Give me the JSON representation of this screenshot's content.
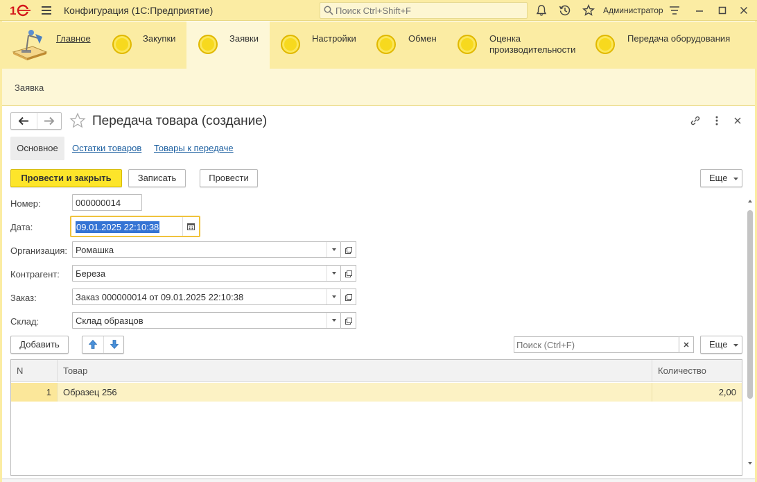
{
  "titlebar": {
    "app_title": "Конфигурация  (1С:Предприятие)",
    "search_placeholder": "Поиск Ctrl+Shift+F",
    "user": "Администратор"
  },
  "sections": [
    {
      "label": "Главное"
    },
    {
      "label": "Закупки"
    },
    {
      "label": "Заявки"
    },
    {
      "label": "Настройки"
    },
    {
      "label": "Обмен"
    },
    {
      "label": "Оценка производительности"
    },
    {
      "label": "Передача оборудования"
    }
  ],
  "active_section": "Заявки",
  "subheader": {
    "item": "Заявка"
  },
  "form": {
    "title": "Передача товара (создание)",
    "tabs": [
      "Основное",
      "Остатки товаров",
      "Товары к передаче"
    ],
    "buttons": {
      "post_close": "Провести и закрыть",
      "save": "Записать",
      "post": "Провести",
      "more": "Еще"
    },
    "fields": {
      "number_label": "Номер:",
      "number_value": "000000014",
      "date_label": "Дата:",
      "date_value": "09.01.2025 22:10:38",
      "org_label": "Организация:",
      "org_value": "Ромашка",
      "counterparty_label": "Контрагент:",
      "counterparty_value": "Береза",
      "order_label": "Заказ:",
      "order_value": "Заказ 000000014 от 09.01.2025 22:10:38",
      "warehouse_label": "Склад:",
      "warehouse_value": "Склад образцов"
    },
    "table_toolbar": {
      "add": "Добавить",
      "search_placeholder": "Поиск (Ctrl+F)",
      "more": "Еще"
    },
    "table": {
      "columns": [
        "N",
        "Товар",
        "Количество"
      ],
      "rows": [
        {
          "n": "1",
          "product": "Образец 256",
          "qty": "2,00"
        }
      ]
    }
  },
  "colors": {
    "accent_yellow": "#fbeca3",
    "primary_button": "#fde52a",
    "link": "#1c5fa0",
    "selection": "#3574d4"
  }
}
